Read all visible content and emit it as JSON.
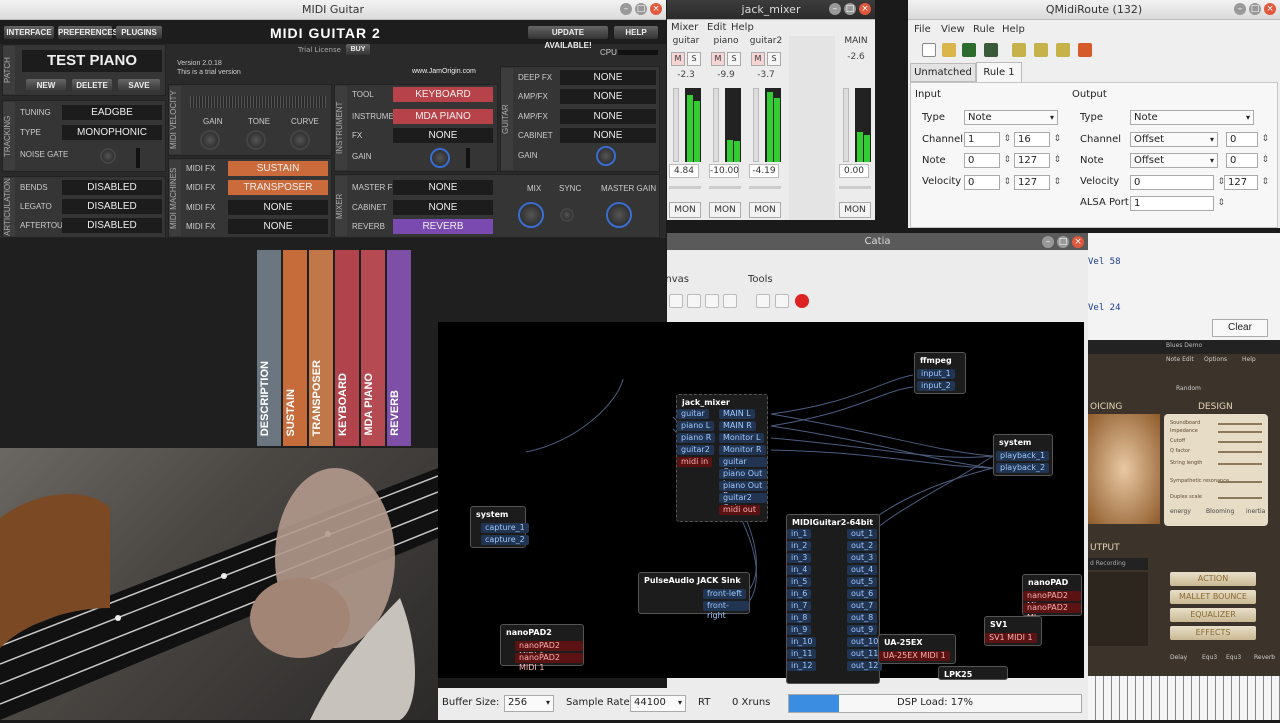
{
  "midi_guitar": {
    "window_title": "MIDI Guitar",
    "nav": [
      "INTERFACE",
      "PREFERENCES",
      "PLUGINS"
    ],
    "logo": "MIDI GUITAR 2",
    "trial_license": "Trial License",
    "buy": "BUY",
    "update": "UPDATE AVAILABLE!",
    "help": "HELP",
    "cpu": "CPU",
    "patch_name": "TEST PIANO",
    "new": "NEW",
    "delete": "DELETE",
    "save": "SAVE",
    "version": "Version 2.0.18",
    "trial_text": "This is a trial version",
    "url": "www.JamOrigin.com",
    "tuning_label": "TUNING",
    "tuning": "EADGBE",
    "type_label": "TYPE",
    "type": "MONOPHONIC",
    "noise_gate": "NOISE GATE",
    "bends_label": "BENDS",
    "bends": "DISABLED",
    "legato_label": "LEGATO",
    "legato": "DISABLED",
    "aftertouch_label": "AFTERTOUCH",
    "aftertouch": "DISABLED",
    "gain": "GAIN",
    "tone": "TONE",
    "curve": "CURVE",
    "midifx_label": "MIDI FX",
    "midifx": [
      "SUSTAIN",
      "TRANSPOSER",
      "NONE",
      "NONE"
    ],
    "tool_label": "TOOL",
    "tool": "KEYBOARD",
    "instrument_label": "INSTRUMENT",
    "instrument": "MDA PIANO",
    "fx_label": "FX",
    "fx": "NONE",
    "inst_gain": "GAIN",
    "deepfx_label": "DEEP FX",
    "deepfx": "NONE",
    "ampfx_label": "AMP/FX",
    "ampfx1": "NONE",
    "ampfx2": "NONE",
    "cabinet_label": "CABINET",
    "cabinet": "NONE",
    "guitar_gain": "GAIN",
    "masterfx_label": "MASTER FX",
    "masterfx": "NONE",
    "cabinet2_label": "CABINET",
    "cabinet2": "NONE",
    "reverb_label": "REVERB",
    "reverb": "REVERB",
    "mix": "MIX",
    "sync": "SYNC",
    "master_gain": "MASTER GAIN",
    "side_labels": {
      "patch": "PATCH",
      "tracking": "TRACKING",
      "articulation": "ARTICULATION",
      "midi_velocity": "MIDI VELOCITY",
      "midi_machines": "MIDI MACHINES",
      "instrument": "INSTRUMENT",
      "guitar": "GUITAR",
      "mixer": "MIXER"
    },
    "bars": [
      "DESCRIPTION",
      "SUSTAIN",
      "TRANSPOSER",
      "KEYBOARD",
      "MDA PIANO",
      "REVERB"
    ]
  },
  "jack_mixer": {
    "title": "jack_mixer",
    "menu": [
      "Mixer",
      "Edit",
      "Help"
    ],
    "channels": [
      {
        "name": "guitar",
        "db": "-2.3",
        "gain": "4.84",
        "meter": 0.9
      },
      {
        "name": "piano",
        "db": "-9.9",
        "gain": "-10.00",
        "meter": 0.3
      },
      {
        "name": "guitar2",
        "db": "-3.7",
        "gain": "-4.19",
        "meter": 0.95
      }
    ],
    "main": {
      "name": "MAIN",
      "db": "-2.6",
      "gain": "0.00",
      "meter": 0.4
    },
    "m": "M",
    "s": "S",
    "mon": "MON"
  },
  "qmidiroute": {
    "title": "QMidiRoute (132)",
    "menu": [
      "File",
      "View",
      "Rule",
      "Help"
    ],
    "tabs": [
      "Unmatched",
      "Rule 1"
    ],
    "input_title": "Input",
    "output_title": "Output",
    "in": {
      "type": "Note",
      "channel_from": "1",
      "channel_to": "16",
      "note_from": "0",
      "note_to": "127",
      "vel_from": "0",
      "vel_to": "127"
    },
    "out": {
      "type": "Note",
      "channel_mode": "Offset",
      "channel_val": "0",
      "note_mode": "Offset",
      "note_val": "0",
      "velocity": "0",
      "vel_to": "127",
      "alsa_port": "1"
    },
    "labels": {
      "type": "Type",
      "channel": "Channel",
      "note": "Note",
      "velocity": "Velocity",
      "alsa": "ALSA Port"
    },
    "log": [
      "Vel  58",
      "Vel  24"
    ],
    "clear": "Clear"
  },
  "catia": {
    "title": "Catia",
    "menu_canvas": "Canvas",
    "menu_tools": "Tools",
    "buffer_label": "Buffer Size:",
    "buffer": "256",
    "rate_label": "Sample Rate:",
    "rate": "44100",
    "rt": "RT",
    "xruns": "0 Xruns",
    "dsp": "DSP Load: 17%",
    "dsp_value": 0.17,
    "nodes": {
      "ffmpeg": {
        "title": "ffmpeg",
        "ports": [
          "input_1",
          "input_2"
        ]
      },
      "jack_mixer": {
        "title": "jack_mixer",
        "in": [
          "guitar",
          "piano L",
          "piano R",
          "guitar2"
        ],
        "midi_in": "midi in",
        "out": [
          "MAIN L",
          "MAIN R",
          "Monitor L",
          "Monitor R",
          "guitar Out",
          "piano Out L",
          "piano Out R",
          "guitar2 Out"
        ],
        "midi_out": "midi out"
      },
      "system_play": {
        "title": "system",
        "ports": [
          "playback_1",
          "playback_2"
        ]
      },
      "system_cap": {
        "title": "system",
        "ports": [
          "capture_1",
          "capture_2"
        ]
      },
      "midiguitar": {
        "title": "MIDIGuitar2-64bit",
        "in": [
          "in_1",
          "in_2",
          "in_3",
          "in_4",
          "in_5",
          "in_6",
          "in_7",
          "in_8",
          "in_9",
          "in_10",
          "in_11",
          "in_12"
        ],
        "out": [
          "out_1",
          "out_2",
          "out_3",
          "out_4",
          "out_5",
          "out_6",
          "out_7",
          "out_8",
          "out_9",
          "out_10",
          "out_11",
          "out_12"
        ]
      },
      "pulse": {
        "title": "PulseAudio JACK Sink",
        "ports": [
          "front-left",
          "front-right"
        ]
      },
      "nanopad": {
        "title": "nanoPAD2",
        "ports": [
          "nanoPAD2 MIDI 1",
          "nanoPAD2 MIDI 1"
        ]
      },
      "nanopad_r": {
        "title": "nanoPAD",
        "ports": [
          "nanoPAD2 MI",
          "nanoPAD2 MI"
        ]
      },
      "sv1": {
        "title": "SV1",
        "ports": [
          "SV1 MIDI 1"
        ]
      },
      "ua25": {
        "title": "UA-25EX",
        "ports": [
          "UA-25EX MIDI 1"
        ]
      },
      "lpk": {
        "title": "LPK25"
      }
    }
  },
  "pianoteq": {
    "voicing": "OICING",
    "design": "DESIGN",
    "output": "UTPUT",
    "buttons": [
      "ACTION",
      "MALLET BOUNCE",
      "EQUALIZER",
      "EFFECTS"
    ],
    "params": [
      "Soundboard",
      "Impedance",
      "Cutoff",
      "Q factor",
      "String length",
      "Sympathetic resonance",
      "Duplex scale"
    ],
    "energy": "energy",
    "blooming": "Blooming",
    "inertia": "inertia",
    "bottom": [
      "Delay",
      "Equ3",
      "Equ3",
      "Reverb"
    ],
    "top": [
      "Blues Demo",
      "Note Edit",
      "Options",
      "Help"
    ],
    "random": "Random",
    "recording": "d Recording"
  }
}
